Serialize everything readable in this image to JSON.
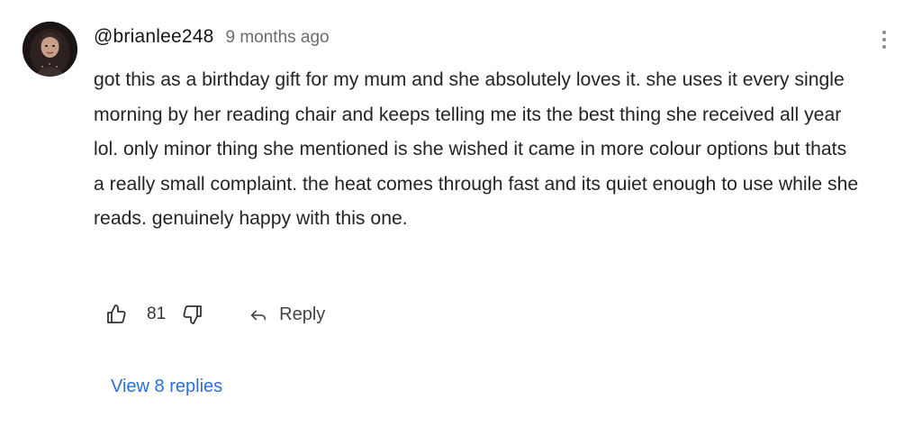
{
  "comment": {
    "username": "@brianlee248",
    "timestamp": "9 months ago",
    "text": "got this as a birthday gift for my mum and she absolutely loves it. she uses it every single morning by her reading chair and keeps telling me its the best thing she received all year lol. only minor thing she mentioned is she wished it came in more colour options but thats a really small complaint. the heat comes through fast and its quiet enough to use while she reads. genuinely happy with this one.",
    "like_count": "81",
    "reply_label": "Reply",
    "view_replies_label": "View 8 replies"
  },
  "icons": {
    "more": "more-vertical-icon",
    "like": "thumbs-up-icon",
    "dislike": "thumbs-down-icon",
    "reply": "reply-arrow-icon"
  },
  "colors": {
    "link": "#2a6fdb",
    "muted": "#6b6b6b",
    "text": "#242424"
  }
}
